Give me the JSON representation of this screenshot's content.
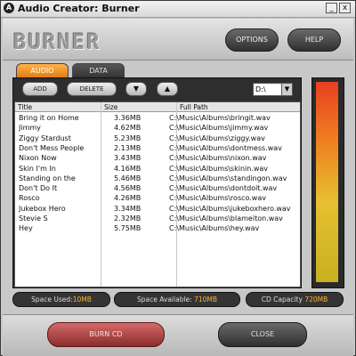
{
  "window": {
    "title": "Audio Creator: Burner",
    "controls": {
      "minimize": "_",
      "close": "x"
    }
  },
  "header": {
    "logo": "BURNER",
    "options_label": "OPTIONS",
    "help_label": "HELP"
  },
  "tabs": [
    {
      "label": "AUDIO",
      "active": true
    },
    {
      "label": "DATA",
      "active": false
    }
  ],
  "toolbar": {
    "add_label": "ADD",
    "delete_label": "DELETE",
    "move_down_icon": "arrow-down",
    "move_up_icon": "arrow-up",
    "drive_value": "D:\\"
  },
  "filelist": {
    "columns": [
      "Title",
      "Size",
      "Full Path"
    ],
    "rows": [
      {
        "title": "Bring it on Home",
        "size": "3.36MB",
        "path": "C:\\Music\\Albums\\bringit.wav"
      },
      {
        "title": "Jimmy",
        "size": "4.62MB",
        "path": "C:\\Music\\Albums\\jimmy.wav"
      },
      {
        "title": "Ziggy Stardust",
        "size": "5.23MB",
        "path": "C:\\Music\\Albums\\ziggy.wav"
      },
      {
        "title": "Don't Mess People",
        "size": "2.13MB",
        "path": "C:\\Music\\Albums\\dontmess.wav"
      },
      {
        "title": "Nixon Now",
        "size": "3.43MB",
        "path": "C:\\Music\\Albums\\nixon.wav"
      },
      {
        "title": "Skin I'm In",
        "size": "4.16MB",
        "path": "C:\\Music\\Albums\\skinin.wav"
      },
      {
        "title": "Standing on the",
        "size": "5.46MB",
        "path": "C:\\Music\\Albums\\standingon.wav"
      },
      {
        "title": "Don't Do It",
        "size": "4.56MB",
        "path": "C:\\Music\\Albums\\dontdoit.wav"
      },
      {
        "title": "Rosco",
        "size": "4.26MB",
        "path": "C:\\Music\\Albums\\rosco.wav"
      },
      {
        "title": "Jukebox Hero",
        "size": "3.34MB",
        "path": "C:\\Music\\Albums\\jukeboxhero.wav"
      },
      {
        "title": "Stevie S",
        "size": "2.32MB",
        "path": "C:\\Music\\Albums\\blameiton.wav"
      },
      {
        "title": "Hey",
        "size": "5.75MB",
        "path": "C:\\Music\\Albums\\hey.wav"
      }
    ]
  },
  "status": {
    "space_used_label": "Space Used:",
    "space_used_value": "10MB",
    "space_available_label": "Space Available:",
    "space_available_value": "710MB",
    "cd_capacity_label": "CD Capacity",
    "cd_capacity_value": "720MB"
  },
  "footer": {
    "burn_label": "BURN CD",
    "close_label": "CLOSE"
  },
  "colors": {
    "accent_tab": "#f0961e",
    "burn_button": "#b84848",
    "status_value": "#ffb030"
  }
}
